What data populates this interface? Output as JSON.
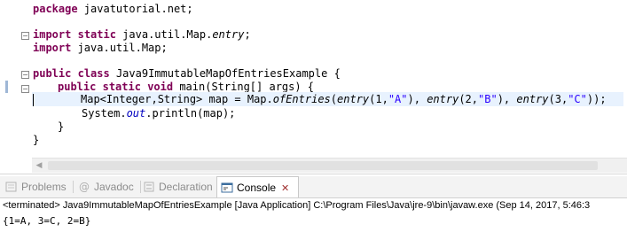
{
  "editor": {
    "lines": {
      "package": {
        "kw": "package",
        "rest": " javatutorial.net;"
      },
      "import1": {
        "kw1": "import",
        "kw2": "static",
        "pre": " java.util.Map.",
        "entry": "entry",
        "post": ";"
      },
      "import2": {
        "kw": "import",
        "rest": " java.util.Map;"
      },
      "class_decl": {
        "kw1": "public",
        "kw2": "class",
        "rest": " Java9ImmutableMapOfEntriesExample {"
      },
      "main_decl": {
        "kw1": "public",
        "kw2": "static",
        "kw3": "void",
        "rest": " main(String[] args) {"
      },
      "map_line": {
        "t1": "Map<Integer,String> map = Map.",
        "ofEntries": "ofEntries",
        "t2": "(",
        "e1": "entry",
        "t3": "(1,",
        "s1": "\"A\"",
        "t4": "), ",
        "e2": "entry",
        "t5": "(2,",
        "s2": "\"B\"",
        "t6": "), ",
        "e3": "entry",
        "t7": "(3,",
        "s3": "\"C\"",
        "t8": "));"
      },
      "println": {
        "t1": "System.",
        "out": "out",
        "t2": ".println(map);"
      },
      "close_method": "}",
      "close_class": "}"
    }
  },
  "views": {
    "tabs": [
      {
        "label": "Problems",
        "icon": "problems-icon"
      },
      {
        "label": "Javadoc",
        "icon": "javadoc-icon"
      },
      {
        "label": "Declaration",
        "icon": "declaration-icon"
      },
      {
        "label": "Console",
        "icon": "console-icon",
        "active": true
      }
    ],
    "close_glyph": "✕"
  },
  "console": {
    "header": "<terminated> Java9ImmutableMapOfEntriesExample [Java Application] C:\\Program Files\\Java\\jre-9\\bin\\javaw.exe (Sep 14, 2017, 5:46:3",
    "output": "{1=A, 3=C, 2=B}"
  },
  "colors": {
    "keyword": "#7f0055",
    "string": "#2a00ff",
    "static_field": "#0000c0",
    "current_line": "#e8f2fe"
  }
}
